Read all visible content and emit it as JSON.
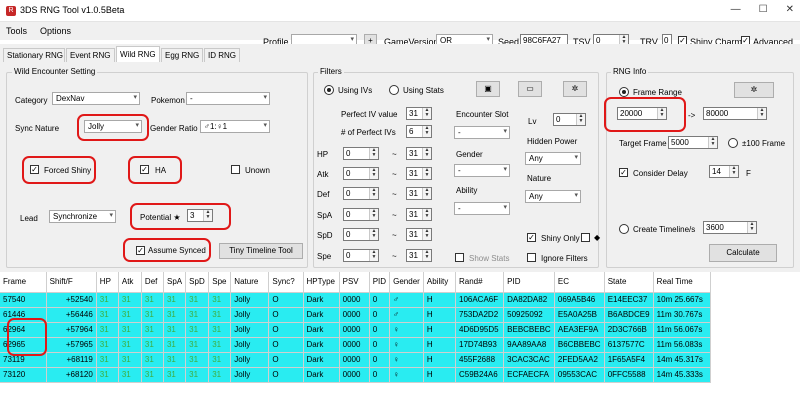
{
  "window": {
    "title": "3DS RNG Tool v1.0.5Beta",
    "icon_text": "R",
    "controls": [
      "—",
      "☐",
      "✕"
    ]
  },
  "menu": [
    "Tools",
    "Options"
  ],
  "header": {
    "profile_label": "Profile",
    "profile_value": "",
    "add_label": "+",
    "gameversion_label": "GameVersion",
    "gameversion_value": "OR",
    "seed_label": "Seed",
    "seed_value": "98C6FA27",
    "tsv_label": "TSV",
    "tsv_value": "0",
    "trv_label": "TRV",
    "trv_value": "0",
    "shiny_charm_label": "Shiny Charm",
    "advanced_label": "Advanced"
  },
  "tabs": [
    "Stationary RNG",
    "Event RNG",
    "Wild RNG",
    "Egg RNG",
    "ID RNG"
  ],
  "encounter": {
    "title": "Wild Encounter Setting",
    "category_label": "Category",
    "category_value": "DexNav",
    "pokemon_label": "Pokemon",
    "pokemon_value": "-",
    "sync_nature_label": "Sync Nature",
    "sync_nature_value": "Jolly",
    "gender_ratio_label": "Gender Ratio",
    "gender_ratio_value": "♂1:♀1",
    "forced_shiny_label": "Forced Shiny",
    "ha_label": "HA",
    "unown_label": "Unown",
    "lead_label": "Lead",
    "lead_value": "Synchronize",
    "potential_label": "Potential ★",
    "potential_value": "3",
    "assume_synced_label": "Assume Synced",
    "tiny_timeline_label": "Tiny Timeline Tool"
  },
  "filters": {
    "title": "Filters",
    "using_ivs_label": "Using IVs",
    "using_stats_label": "Using Stats",
    "perfect_iv_value_label": "Perfect IV value",
    "perfect_iv_value": "31",
    "num_perfect_label": "# of Perfect IVs",
    "num_perfect_value": "6",
    "stats": [
      {
        "name": "HP",
        "min": "0",
        "max": "31"
      },
      {
        "name": "Atk",
        "min": "0",
        "max": "31"
      },
      {
        "name": "Def",
        "min": "0",
        "max": "31"
      },
      {
        "name": "SpA",
        "min": "0",
        "max": "31"
      },
      {
        "name": "SpD",
        "min": "0",
        "max": "31"
      },
      {
        "name": "Spe",
        "min": "0",
        "max": "31"
      }
    ],
    "tilde": "~",
    "encounter_slot_label": "Encounter Slot",
    "encounter_slot_value": "-",
    "gender_label": "Gender",
    "gender_value": "-",
    "ability_label": "Ability",
    "ability_value": "-",
    "lv_label": "Lv",
    "lv_value": "0",
    "hidden_power_label": "Hidden Power",
    "hidden_power_value": "Any",
    "nature_label": "Nature",
    "nature_value": "Any",
    "show_stats_label": "Show Stats",
    "shiny_only_label": "Shiny Only",
    "diamond": "◆",
    "ignore_filters_label": "Ignore Filters"
  },
  "rnginfo": {
    "title": "RNG Info",
    "frame_range_label": "Frame Range",
    "frame_start": "20000",
    "arrow": "->",
    "frame_end": "80000",
    "target_frame_label": "Target Frame",
    "target_frame_value": "5000",
    "plus100_label": "±100 Frame",
    "consider_delay_label": "Consider Delay",
    "delay_value": "14",
    "f_label": "F",
    "create_timeline_label": "Create Timeline/s",
    "timeline_value": "3600",
    "calculate_label": "Calculate"
  },
  "results": {
    "columns": [
      "Frame",
      "Shift/F",
      "HP",
      "Atk",
      "Def",
      "SpA",
      "SpD",
      "Spe",
      "Nature",
      "Sync?",
      "HPType",
      "PSV",
      "PID",
      "Gender",
      "Ability",
      "Rand#",
      "PID",
      "EC",
      "State",
      "Real Time"
    ],
    "rows": [
      [
        "57540",
        "+52540",
        "31",
        "31",
        "31",
        "31",
        "31",
        "31",
        "Jolly",
        "O",
        "Dark",
        "0000",
        "0",
        "♂",
        "H",
        "106ACA6F",
        "DA82DA82",
        "069A5B46",
        "E14EEC37",
        "10m 25.667s"
      ],
      [
        "61446",
        "+56446",
        "31",
        "31",
        "31",
        "31",
        "31",
        "31",
        "Jolly",
        "O",
        "Dark",
        "0000",
        "0",
        "♂",
        "H",
        "753DA2D2",
        "50925092",
        "E5A0A25B",
        "B6ABDCE9",
        "11m 30.767s"
      ],
      [
        "62964",
        "+57964",
        "31",
        "31",
        "31",
        "31",
        "31",
        "31",
        "Jolly",
        "O",
        "Dark",
        "0000",
        "0",
        "♀",
        "H",
        "4D6D95D5",
        "BEBCBEBC",
        "AEA3EF9A",
        "2D3C766B",
        "11m 56.067s"
      ],
      [
        "62965",
        "+57965",
        "31",
        "31",
        "31",
        "31",
        "31",
        "31",
        "Jolly",
        "O",
        "Dark",
        "0000",
        "0",
        "♀",
        "H",
        "17D74B93",
        "9AA89AA8",
        "B6CBBEBC",
        "6137577C",
        "11m 56.083s"
      ],
      [
        "73119",
        "+68119",
        "31",
        "31",
        "31",
        "31",
        "31",
        "31",
        "Jolly",
        "O",
        "Dark",
        "0000",
        "0",
        "♀",
        "H",
        "455F2688",
        "3CAC3CAC",
        "2FED5AA2",
        "1F65A5F4",
        "14m 45.317s"
      ],
      [
        "73120",
        "+68120",
        "31",
        "31",
        "31",
        "31",
        "31",
        "31",
        "Jolly",
        "O",
        "Dark",
        "0000",
        "0",
        "♀",
        "H",
        "C59B24A6",
        "ECFAECFA",
        "09553CAC",
        "0FFC5588",
        "14m 45.333s"
      ]
    ]
  },
  "colors": {
    "row_bg": "#29ecf1",
    "iv_text": "#3fae3f",
    "highlight": "#e01818"
  }
}
